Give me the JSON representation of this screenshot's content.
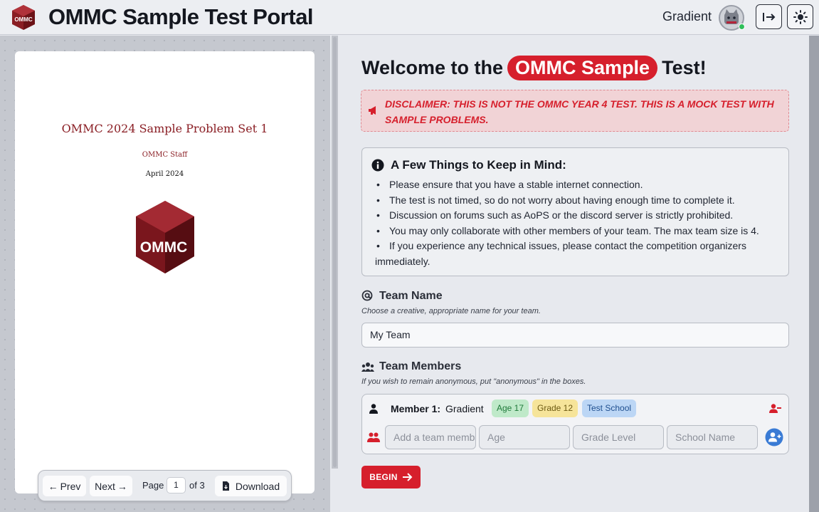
{
  "header": {
    "title": "OMMC Sample Test Portal",
    "logo_text": "OMMC",
    "user_name": "Gradient"
  },
  "pdf": {
    "title": "OMMC 2024 Sample Problem Set 1",
    "author": "OMMC Staff",
    "date": "April 2024",
    "logo_text": "OMMC",
    "toolbar": {
      "prev_label": "Prev",
      "next_label": "Next",
      "page_label": "Page",
      "page_value": "1",
      "of_label": "of 3",
      "download_label": "Download"
    }
  },
  "main": {
    "welcome_prefix": "Welcome to the",
    "welcome_highlight": "OMMC Sample",
    "welcome_suffix": "Test!",
    "disclaimer": "DISCLAIMER: THIS IS NOT THE OMMC YEAR 4 TEST. THIS IS A MOCK TEST WITH SAMPLE PROBLEMS.",
    "keep_in_mind": {
      "title": "A Few Things to Keep in Mind:",
      "items": [
        "Please ensure that you have a stable internet connection.",
        "The test is not timed, so do not worry about having enough time to complete it.",
        "Discussion on forums such as AoPS or the discord server is strictly prohibited.",
        "You may only collaborate with other members of your team. The max team size is 4.",
        "If you experience any technical issues, please contact the competition organizers immediately."
      ]
    },
    "team_name": {
      "label": "Team Name",
      "hint": "Choose a creative, appropriate name for your team.",
      "value": "My Team"
    },
    "team_members": {
      "label": "Team Members",
      "hint": "If you wish to remain anonymous, put \"anonymous\" in the boxes.",
      "member_label": "Member 1:",
      "member_name": "Gradient",
      "age_badge": "Age 17",
      "grade_badge": "Grade 12",
      "school_badge": "Test School",
      "name_placeholder": "Add a team member",
      "age_placeholder": "Age",
      "grade_placeholder": "Grade Level",
      "school_placeholder": "School Name"
    },
    "begin_label": "BEGIN"
  },
  "colors": {
    "accent": "#d61f2c",
    "brand_dark_red": "#8a1e24",
    "online": "#2fbf5a",
    "add_blue": "#3a7bd5"
  }
}
